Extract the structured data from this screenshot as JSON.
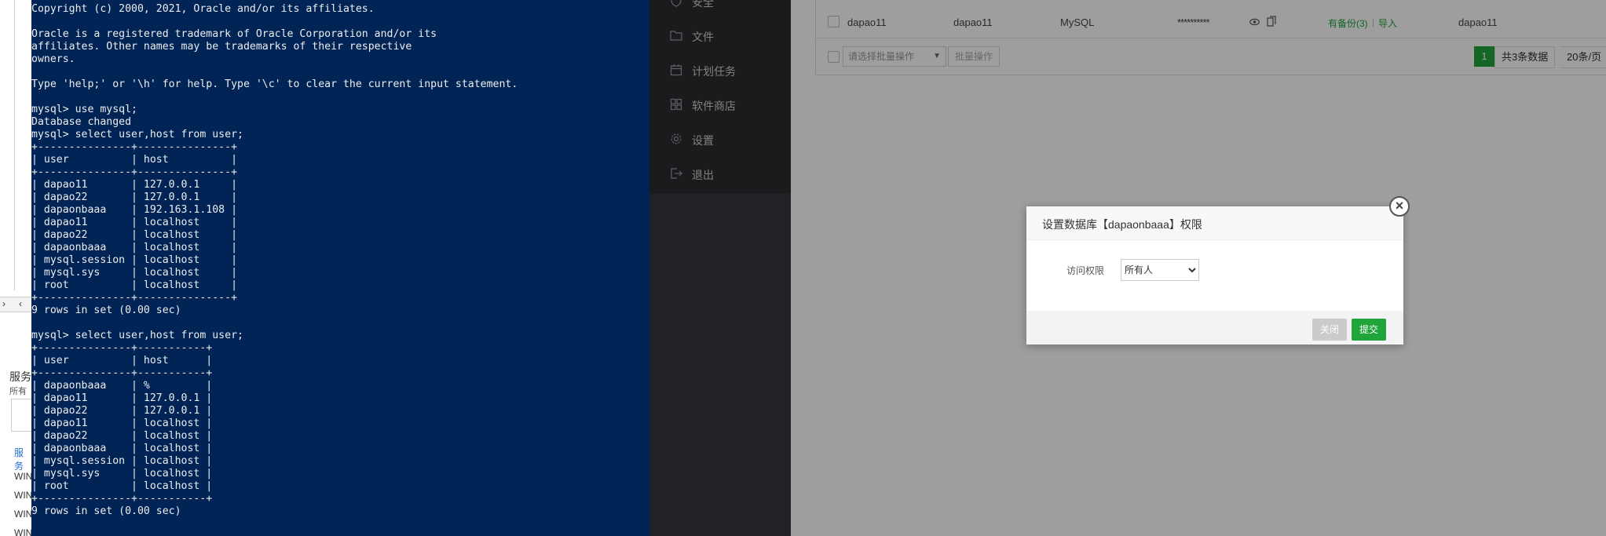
{
  "terminal": {
    "lines": [
      "Copyright (c) 2000, 2021, Oracle and/or its affiliates.",
      "",
      "Oracle is a registered trademark of Oracle Corporation and/or its",
      "affiliates. Other names may be trademarks of their respective",
      "owners.",
      "",
      "Type 'help;' or '\\h' for help. Type '\\c' to clear the current input statement.",
      "",
      "mysql> use mysql;",
      "Database changed",
      "mysql> select user,host from user;",
      "+---------------+---------------+",
      "| user          | host          |",
      "+---------------+---------------+",
      "| dapao11       | 127.0.0.1     |",
      "| dapao22       | 127.0.0.1     |",
      "| dapaonbaaa    | 192.163.1.108 |",
      "| dapao11       | localhost     |",
      "| dapao22       | localhost     |",
      "| dapaonbaaa    | localhost     |",
      "| mysql.session | localhost     |",
      "| mysql.sys     | localhost     |",
      "| root          | localhost     |",
      "+---------------+---------------+",
      "9 rows in set (0.00 sec)",
      "",
      "mysql> select user,host from user;",
      "+---------------+-----------+",
      "| user          | host      |",
      "+---------------+-----------+",
      "| dapaonbaaa    | %         |",
      "| dapao11       | 127.0.0.1 |",
      "| dapao22       | 127.0.0.1 |",
      "| dapao11       | localhost |",
      "| dapao22       | localhost |",
      "| dapaonbaaa    | localhost |",
      "| mysql.session | localhost |",
      "| mysql.sys     | localhost |",
      "| root          | localhost |",
      "+---------------+-----------+",
      "9 rows in set (0.00 sec)"
    ]
  },
  "left_window": {
    "service_title": "服务",
    "service_sub": "所有",
    "service_link": "服务",
    "rows": [
      "WIN",
      "WIN",
      "WIN",
      "WIN"
    ]
  },
  "sidebar": {
    "items": [
      {
        "label": "安全",
        "icon": "shield-icon"
      },
      {
        "label": "文件",
        "icon": "folder-icon"
      },
      {
        "label": "计划任务",
        "icon": "calendar-icon"
      },
      {
        "label": "软件商店",
        "icon": "grid-icon"
      },
      {
        "label": "设置",
        "icon": "gear-icon"
      },
      {
        "label": "退出",
        "icon": "logout-icon"
      }
    ]
  },
  "table": {
    "row": {
      "name": "dapao11",
      "user": "dapao11",
      "type": "MySQL",
      "password": "**********",
      "backup": "有备份(3)",
      "separator": "|",
      "import": "导入",
      "remark": "dapao11"
    },
    "batch_select_placeholder": "请选择批量操作",
    "batch_button": "批量操作",
    "pagination": {
      "current": "1",
      "total": "共3条数据",
      "per_page": "20条/页"
    },
    "colors": {
      "green": "#20a53a"
    }
  },
  "dialog": {
    "title": "设置数据库【dapaonbaaa】权限",
    "access_label": "访问权限",
    "access_value": "所有人",
    "close_label": "关闭",
    "submit_label": "提交",
    "close_icon": "×"
  }
}
